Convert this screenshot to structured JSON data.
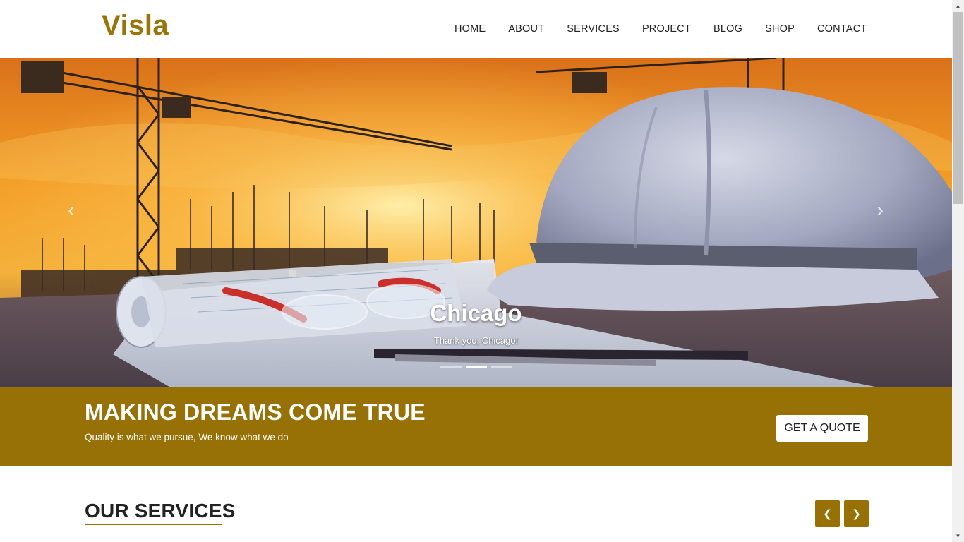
{
  "brand": {
    "logo": "Visla",
    "accent_color": "#977006"
  },
  "nav": {
    "items": [
      {
        "label": "HOME"
      },
      {
        "label": "ABOUT"
      },
      {
        "label": "SERVICES"
      },
      {
        "label": "PROJECT"
      },
      {
        "label": "BLOG"
      },
      {
        "label": "SHOP"
      },
      {
        "label": "CONTACT"
      }
    ]
  },
  "hero": {
    "image": "construction-helmet-blueprints-cranes-sunset",
    "caption_title": "Chicago",
    "caption_subtitle": "Thank you, Chicago!",
    "prev_icon": "chevron-left-icon",
    "next_icon": "chevron-right-icon",
    "slide_count": 3,
    "active_slide": 2
  },
  "banner": {
    "title": "MAKING DREAMS COME TRUE",
    "subtitle": "Quality is what we pursue, We know what we do",
    "button_label": "GET A QUOTE"
  },
  "services": {
    "title": "OUR SERVICES",
    "prev_icon": "chevron-left-icon",
    "next_icon": "chevron-right-icon"
  }
}
